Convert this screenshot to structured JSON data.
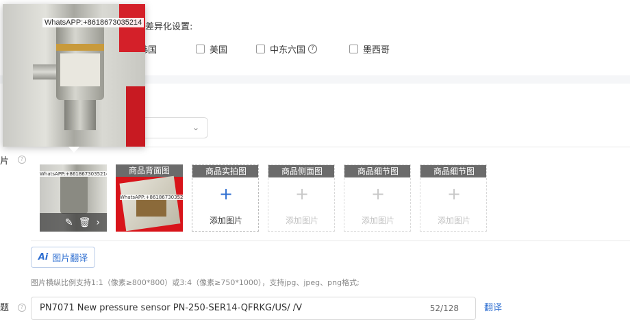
{
  "diff": {
    "label": "差异化设置:",
    "countries": [
      {
        "label": "韩国"
      },
      {
        "label": "美国"
      },
      {
        "label": "中东六国"
      },
      {
        "label": "墨西哥"
      }
    ]
  },
  "images": {
    "label": "片",
    "translate_button": "图片翻译",
    "ai_badge": "Ai",
    "hint": "图片横纵比例支持1:1（像素≥800*800）或3:4（像素≥750*1000），支持jpg、jpeg、png格式;",
    "add_label": "添加图片",
    "slots": [
      {
        "tag": ""
      },
      {
        "tag": "商品背面图"
      },
      {
        "tag": "商品实拍图"
      },
      {
        "tag": "商品侧面图"
      },
      {
        "tag": "商品细节图"
      },
      {
        "tag": "商品细节图"
      }
    ]
  },
  "preview": {
    "watermark": "WhatsAPP:+8618673035214"
  },
  "title": {
    "label": "题",
    "value": "PN7071 New pressure sensor PN-250-SER14-QFRKG/US/ /V",
    "count": "52/128",
    "translate_link": "翻译"
  },
  "colors": {
    "accent": "#2f6fd1",
    "tag_bg": "#6b6b6b",
    "red_photo": "#d8141a"
  }
}
